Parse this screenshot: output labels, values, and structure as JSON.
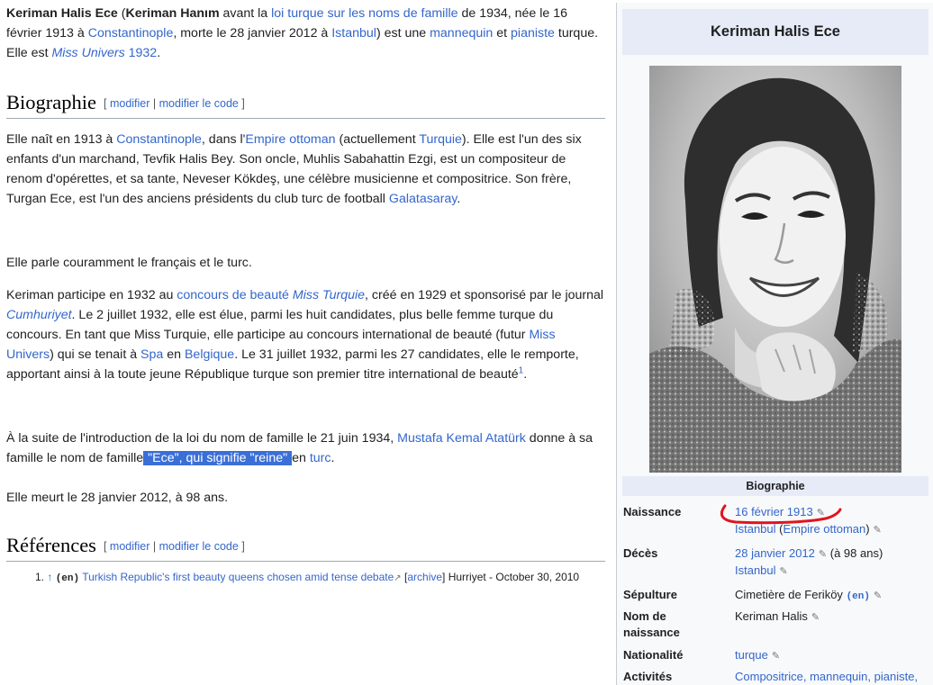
{
  "intro": {
    "name": "Keriman Halis Ece",
    "open_paren": " (",
    "maiden_name": "Keriman Hanım",
    "t1": " avant la ",
    "law_link": "loi turque sur les noms de famille",
    "t2": " de 1934, née le 16 février 1913 à ",
    "birth_city_link": "Constantinople",
    "t3": ", morte le 28 janvier 2012 à ",
    "death_city_link": "Istanbul",
    "t4": ") est une ",
    "model_link": "mannequin",
    "t5": " et ",
    "pianist_link": "pianiste",
    "t6": " turque. Elle est ",
    "miss_link": "Miss Univers",
    "t7": " ",
    "year_link": "1932",
    "t8": "."
  },
  "section_edit": {
    "open": "[",
    "modify": "modifier",
    "sep": " | ",
    "modify_code": "modifier le code",
    "close": "]"
  },
  "biography": {
    "heading": "Biographie",
    "p1": {
      "a": "Elle naît en 1913 à ",
      "l1": "Constantinople",
      "b": ", dans l'",
      "l2": "Empire ottoman",
      "c": " (actuellement ",
      "l3": "Turquie",
      "d": "). Elle est l'un des six enfants d'un marchand, Tevfik Halis Bey. Son oncle, Muhlis Sabahattin Ezgi, est un compositeur de renom d'opérettes, et sa tante, Neveser Kökdeş, une célèbre musicienne et compositrice. Son frère, Turgan Ece, est l'un des anciens présidents du club turc de football ",
      "l4": "Galatasaray",
      "e": "."
    },
    "p2": "Elle parle couramment le français et le turc.",
    "p3": {
      "a": "Keriman participe en 1932 au ",
      "l1": "concours de beauté ",
      "l1i": "Miss Turquie",
      "b": ", créé en 1929 et sponsorisé par le journal ",
      "l2": "Cumhuriyet",
      "c": ". Le 2 juillet 1932, elle est élue, parmi les huit candidates, plus belle femme turque du concours. En tant que Miss Turquie, elle participe au concours international de beauté (futur ",
      "l3": "Miss Univers",
      "d": ") qui se tenait à ",
      "l4": "Spa",
      "e": " en ",
      "l5": "Belgique",
      "f": ". Le 31 juillet 1932, parmi les 27 candidates, elle le remporte, apportant ainsi à la toute jeune République turque son premier titre international de beauté",
      "sup": "1",
      "g": "."
    },
    "p4": {
      "a": "À la suite de l'introduction de la loi du nom de famille le 21 juin 1934, ",
      "l1": "Mustafa Kemal Atatürk",
      "b": " donne à sa famille le nom de famille",
      "selected": " \"Ece\", qui signifie \"reine\" ",
      "c": "en ",
      "l2": "turc",
      "d": "."
    },
    "p5": "Elle meurt le 28 janvier 2012, à 98 ans."
  },
  "references": {
    "heading": "Références",
    "items": [
      {
        "num": "1.",
        "arrow": "↑",
        "lang": "(en)",
        "title": "Turkish Republic's first beauty queens chosen amid tense debate",
        "ext": "↗",
        "archive_open": " [",
        "archive": "archive",
        "archive_close": "] ",
        "source": "Hurriyet - October 30, 2010"
      }
    ]
  },
  "infobox": {
    "title": "Keriman Halis Ece",
    "section": "Biographie",
    "rows": {
      "naissance": {
        "label": "Naissance",
        "date_link": "16 février 1913",
        "place_link": "Istanbul",
        "place_sep": " (",
        "empire_link": "Empire ottoman",
        "place_close": ")"
      },
      "deces": {
        "label": "Décès",
        "date_link": "28 janvier 2012",
        "age": "(à 98 ans)",
        "place_link": "Istanbul"
      },
      "sepulture": {
        "label": "Sépulture",
        "value": "Cimetière de Feriköy",
        "lang": "(en)"
      },
      "nom": {
        "label": "Nom de naissance",
        "value": "Keriman Halis"
      },
      "nationalite": {
        "label": "Nationalité",
        "value_link": "turque"
      },
      "activites": {
        "label": "Activités",
        "value_link": "Compositrice, mannequin, pianiste,"
      }
    },
    "edit_icon": "pencil-icon",
    "annotation_color": "#e0141e"
  }
}
